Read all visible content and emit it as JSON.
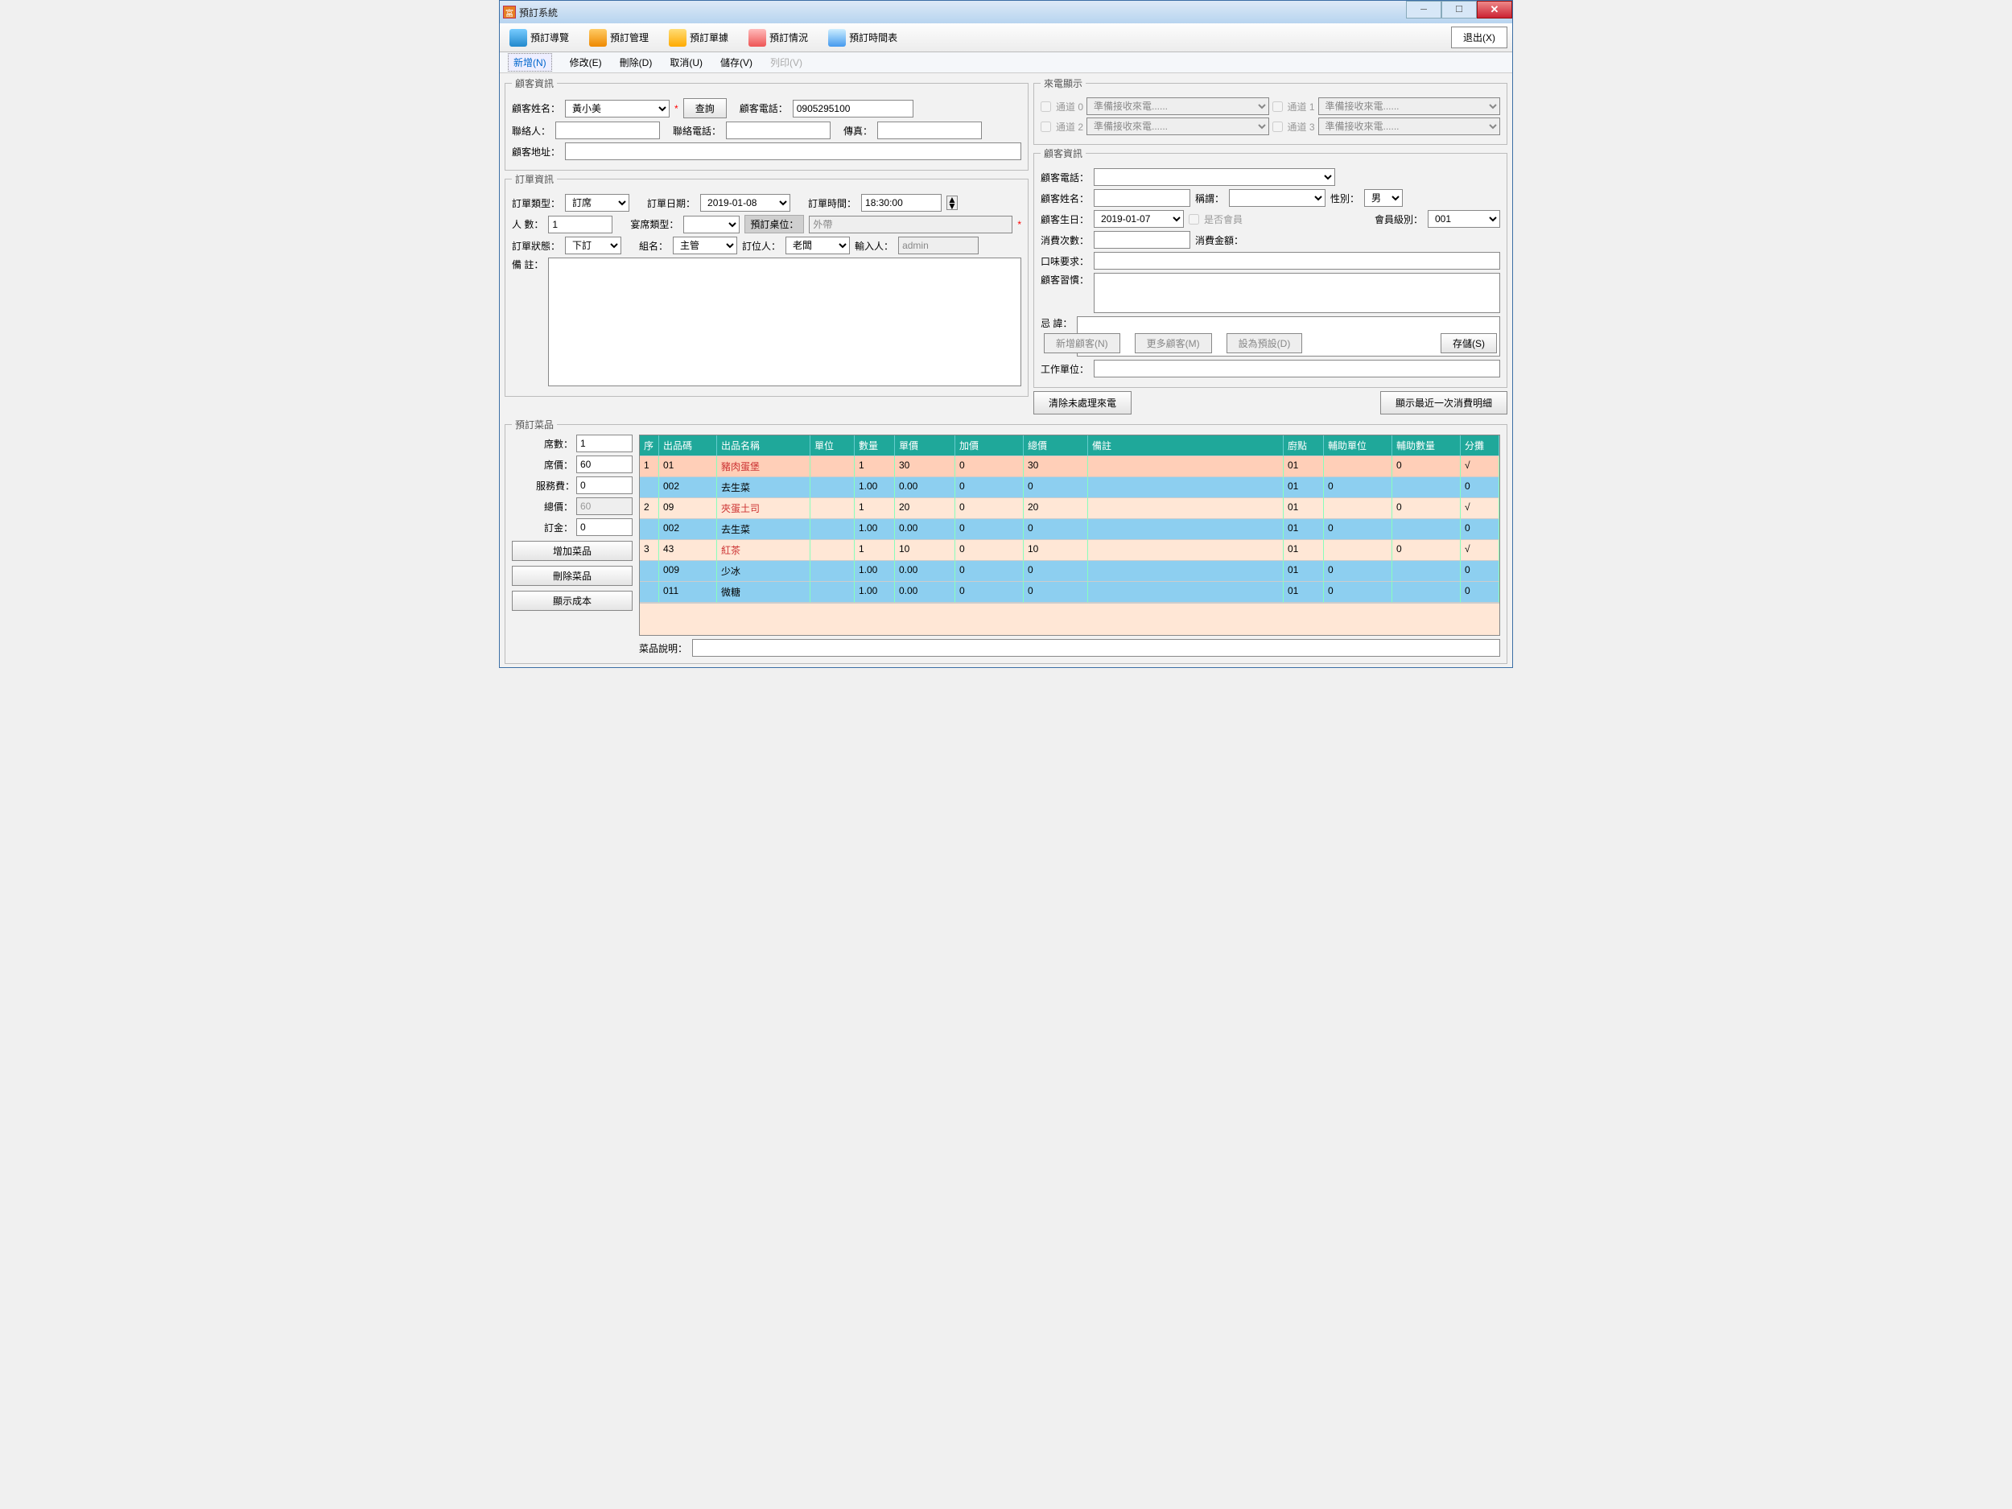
{
  "window": {
    "title": "預訂系統"
  },
  "toolbar": {
    "nav": "預訂導覽",
    "mgmt": "預訂管理",
    "doc": "預訂單據",
    "stat": "預訂情況",
    "sched": "預訂時間表",
    "exit": "退出(X)"
  },
  "menu": {
    "new": "新增(N)",
    "edit": "修改(E)",
    "del": "刪除(D)",
    "cancel": "取消(U)",
    "save": "儲存(V)",
    "print": "列印(V)"
  },
  "customer": {
    "legend": "顧客資訊",
    "name_lbl": "顧客姓名：",
    "name_val": "黃小美",
    "query_btn": "查詢",
    "phone_lbl": "顧客電話：",
    "phone_val": "0905295100",
    "contact_lbl": "聯絡人：",
    "contact_val": "",
    "contact_phone_lbl": "聯絡電話：",
    "contact_phone_val": "",
    "fax_lbl": "傳真：",
    "fax_val": "",
    "addr_lbl": "顧客地址：",
    "addr_val": ""
  },
  "order": {
    "legend": "訂單資訊",
    "type_lbl": "訂單類型：",
    "type_val": "訂席",
    "date_lbl": "訂單日期：",
    "date_val": "2019-01-08",
    "time_lbl": "訂單時間：",
    "time_val": "18:30:00",
    "people_lbl": "人  數：",
    "people_val": "1",
    "banquet_lbl": "宴席類型：",
    "banquet_val": "",
    "table_lbl": "預訂桌位：",
    "table_val": "外帶",
    "status_lbl": "訂單狀態：",
    "status_val": "下訂",
    "group_lbl": "組名：",
    "group_val": "主管",
    "booker_lbl": "訂位人：",
    "booker_val": "老闆",
    "entry_lbl": "輸入人：",
    "entry_val": "admin",
    "remark_lbl": "備  註："
  },
  "callerid": {
    "legend": "來電顯示",
    "ch0": "通道 0",
    "ch1": "通道 1",
    "ch2": "通道 2",
    "ch3": "通道 3",
    "waiting": "準備接收來電......"
  },
  "cust2": {
    "legend": "顧客資訊",
    "phone_lbl": "顧客電話：",
    "name_lbl": "顧客姓名：",
    "title_lbl": "稱謂：",
    "gender_lbl": "性別：",
    "gender_val": "男",
    "bday_lbl": "顧客生日：",
    "bday_val": "2019-01-07",
    "member_chk": "是否會員",
    "memlvl_lbl": "會員級別：",
    "memlvl_val": "001",
    "visits_lbl": "消費次數：",
    "amount_lbl": "消費金額：",
    "taste_lbl": "口味要求：",
    "habit_lbl": "顧客習慣：",
    "taboo_lbl": "忌  諱：",
    "work_lbl": "工作單位：",
    "addcust_btn": "新增顧客(N)",
    "editcust_btn": "更多顧客(M)",
    "setdef_btn": "設為預設(D)",
    "save_btn": "存儲(S)",
    "clear_btn": "清除未處理來電",
    "recent_btn": "顯示最近一次消費明細"
  },
  "dish": {
    "legend": "預訂菜品",
    "seats_lbl": "席數：",
    "seats_val": "1",
    "seatprice_lbl": "席價：",
    "seatprice_val": "60",
    "svc_lbl": "服務費：",
    "svc_val": "0",
    "total_lbl": "總價：",
    "total_val": "60",
    "deposit_lbl": "訂金：",
    "deposit_val": "0",
    "add_btn": "增加菜品",
    "del_btn": "刪除菜品",
    "cost_btn": "顯示成本",
    "desc_lbl": "菜品說明："
  },
  "grid": {
    "headers": {
      "seq": "序",
      "code": "出品碼",
      "name": "出品名稱",
      "unit": "單位",
      "qty": "數量",
      "price": "單價",
      "add": "加價",
      "total": "總價",
      "note": "備註",
      "kit": "廚點",
      "au": "輔助單位",
      "aq": "輔助數量",
      "split": "分攤"
    },
    "rows": [
      {
        "t": "m",
        "sel": true,
        "seq": "1",
        "code": "01",
        "name": "豬肉蛋堡",
        "unit": "",
        "qty": "1",
        "price": "30",
        "add": "0",
        "total": "30",
        "note": "",
        "kit": "01",
        "au": "",
        "aq": "0",
        "split": "√"
      },
      {
        "t": "s",
        "seq": "",
        "code": "002",
        "name": "去生菜",
        "unit": "",
        "qty": "1.00",
        "price": "0.00",
        "add": "0",
        "total": "0",
        "note": "",
        "kit": "01",
        "au": "0",
        "aq": "",
        "split": "0"
      },
      {
        "t": "m",
        "seq": "2",
        "code": "09",
        "name": "夾蛋土司",
        "unit": "",
        "qty": "1",
        "price": "20",
        "add": "0",
        "total": "20",
        "note": "",
        "kit": "01",
        "au": "",
        "aq": "0",
        "split": "√"
      },
      {
        "t": "s",
        "seq": "",
        "code": "002",
        "name": "去生菜",
        "unit": "",
        "qty": "1.00",
        "price": "0.00",
        "add": "0",
        "total": "0",
        "note": "",
        "kit": "01",
        "au": "0",
        "aq": "",
        "split": "0"
      },
      {
        "t": "m",
        "seq": "3",
        "code": "43",
        "name": "紅茶",
        "unit": "",
        "qty": "1",
        "price": "10",
        "add": "0",
        "total": "10",
        "note": "",
        "kit": "01",
        "au": "",
        "aq": "0",
        "split": "√"
      },
      {
        "t": "s",
        "seq": "",
        "code": "009",
        "name": "少冰",
        "unit": "",
        "qty": "1.00",
        "price": "0.00",
        "add": "0",
        "total": "0",
        "note": "",
        "kit": "01",
        "au": "0",
        "aq": "",
        "split": "0"
      },
      {
        "t": "s",
        "seq": "",
        "code": "011",
        "name": "微糖",
        "unit": "",
        "qty": "1.00",
        "price": "0.00",
        "add": "0",
        "total": "0",
        "note": "",
        "kit": "01",
        "au": "0",
        "aq": "",
        "split": "0"
      }
    ]
  }
}
